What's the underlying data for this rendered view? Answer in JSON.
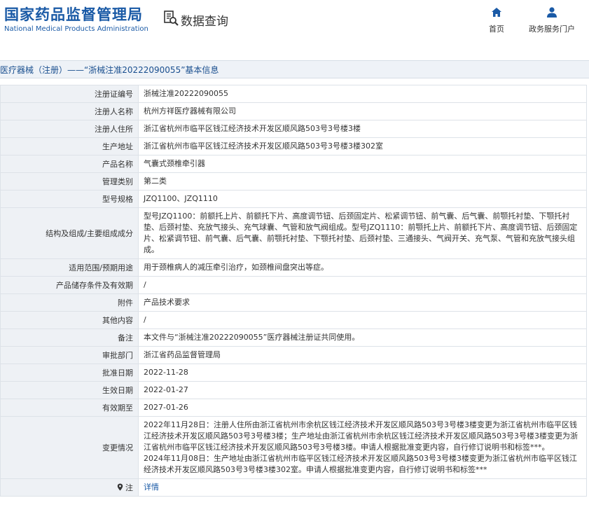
{
  "header": {
    "logo_cn": "国家药品监督管理局",
    "logo_en": "National Medical Products Administration",
    "query_label": "数据查询",
    "nav": [
      {
        "label": "首页",
        "icon": "home-icon"
      },
      {
        "label": "政务服务门户",
        "icon": "user-icon"
      }
    ]
  },
  "breadcrumb": "医疗器械（注册）——“浙械注准20222090055”基本信息",
  "colors": {
    "brand": "#1a5aa6",
    "label_bg": "#eef1f5",
    "border": "#dde2e8"
  },
  "rows": [
    {
      "label": "注册证编号",
      "value": "浙械注准20222090055"
    },
    {
      "label": "注册人名称",
      "value": "杭州方祥医疗器械有限公司"
    },
    {
      "label": "注册人住所",
      "value": "浙江省杭州市临平区钱江经济技术开发区顺风路503号3号楼3楼"
    },
    {
      "label": "生产地址",
      "value": "浙江省杭州市临平区钱江经济技术开发区顺风路503号3号楼3楼302室"
    },
    {
      "label": "产品名称",
      "value": "气囊式颈椎牵引器"
    },
    {
      "label": "管理类别",
      "value": "第二类"
    },
    {
      "label": "型号规格",
      "value": "JZQ1100、JZQ1110"
    },
    {
      "label": "结构及组成/主要组成成分",
      "value": "型号JZQ1100：前额托上片、前额托下片、高度调节钮、后颈固定片、松紧调节钮、前气囊、后气囊、前颚托衬垫、下颚托衬垫、后颈衬垫、充放气接头、充气球囊、气管和放气阀组成。型号JZQ1110：前颚托上片、前额托下片、高度调节钮、后颈固定片、松紧调节钮、前气囊、后气囊、前颚托衬垫、下颚托衬垫、后颈衬垫、三通接头、气阀开关、充气泵、气管和充放气接头组成。"
    },
    {
      "label": "适用范围/预期用途",
      "value": "用于颈椎病人的减压牵引治疗，如颈椎间盘突出等症。"
    },
    {
      "label": "产品储存条件及有效期",
      "value": "/"
    },
    {
      "label": "附件",
      "value": "产品技术要求"
    },
    {
      "label": "其他内容",
      "value": "/"
    },
    {
      "label": "备注",
      "value": "本文件与“浙械注准20222090055”医疗器械注册证共同使用。"
    },
    {
      "label": "审批部门",
      "value": "浙江省药品监督管理局"
    },
    {
      "label": "批准日期",
      "value": "2022-11-28"
    },
    {
      "label": "生效日期",
      "value": "2022-01-27"
    },
    {
      "label": "有效期至",
      "value": "2027-01-26"
    },
    {
      "label": "变更情况",
      "value": "2022年11月28日：注册人住所由浙江省杭州市余杭区钱江经济技术开发区顺风路503号3号楼3楼变更为浙江省杭州市临平区钱江经济技术开发区顺风路503号3号楼3楼；生产地址由浙江省杭州市余杭区钱江经济技术开发区顺风路503号3号楼3楼变更为浙江省杭州市临平区钱江经济技术开发区顺风路503号3号楼3楼。申请人根据批准变更内容，自行修订说明书和标签***。",
      "value2": "2024年11月08日：生产地址由浙江省杭州市临平区钱江经济技术开发区顺风路503号3号楼3楼变更为浙江省杭州市临平区钱江经济技术开发区顺风路503号3号楼3楼302室。申请人根据批准变更内容，自行修订说明书和标签***"
    }
  ],
  "note_row": {
    "label": "注",
    "icon": "pin-icon",
    "link": "详情"
  }
}
